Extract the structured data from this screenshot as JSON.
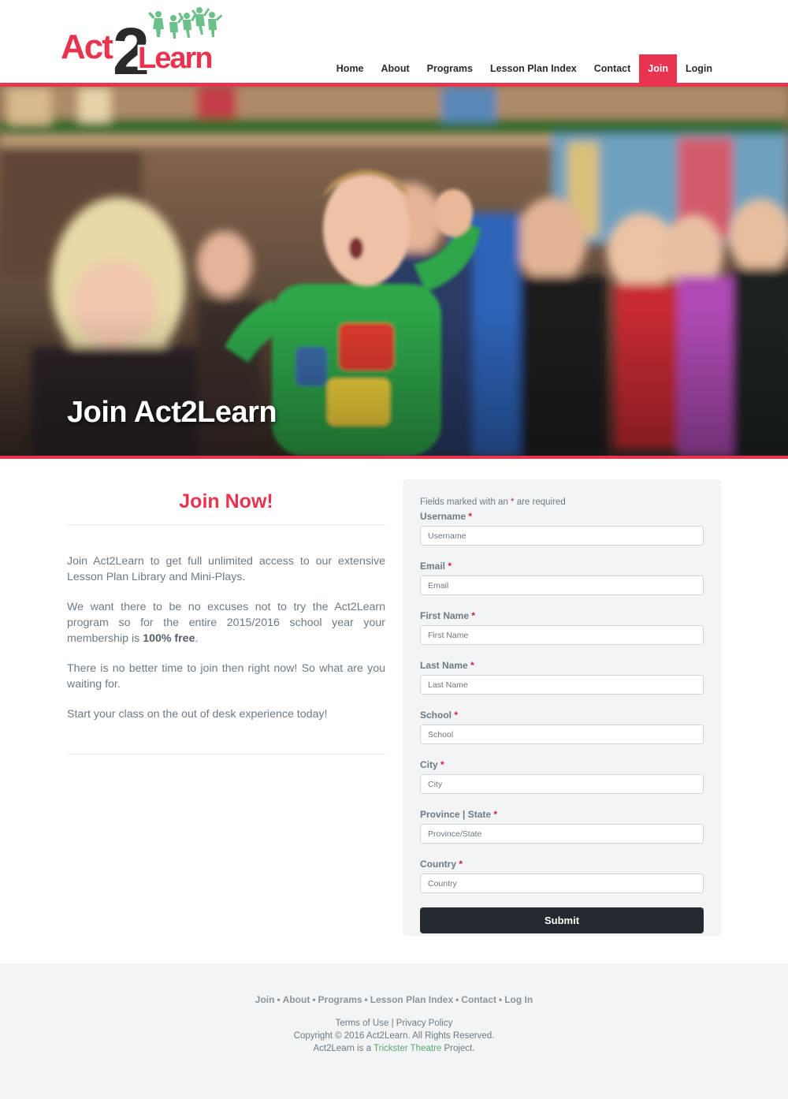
{
  "brand": {
    "logo_text_left": "Act",
    "logo_text_num": "2",
    "logo_text_right": "Learn"
  },
  "nav": {
    "items": [
      {
        "label": "Home"
      },
      {
        "label": "About"
      },
      {
        "label": "Programs"
      },
      {
        "label": "Lesson Plan Index"
      },
      {
        "label": "Contact"
      },
      {
        "label": "Join",
        "active": true
      },
      {
        "label": "Login"
      }
    ]
  },
  "hero": {
    "title": "Join Act2Learn"
  },
  "intro": {
    "heading": "Join Now!",
    "p1": "Join Act2Learn to get full unlimited access to our extensive Lesson Plan Library and Mini-Plays.",
    "p2_pre": "We want there to be no excuses not to try the Act2Learn program so for the entire 2015/2016 school year your membership is ",
    "p2_bold": "100% free",
    "p2_post": ".",
    "p3": "There is no better time to join then right now! So what are you waiting for.",
    "p4": "Start your class on the out of desk experience today!"
  },
  "form": {
    "required_note_pre": "Fields marked with an ",
    "required_star": "*",
    "required_note_post": " are required",
    "fields": [
      {
        "label": "Username",
        "placeholder": "Username"
      },
      {
        "label": "Email",
        "placeholder": "Email"
      },
      {
        "label": "First Name",
        "placeholder": "First Name"
      },
      {
        "label": "Last Name",
        "placeholder": "Last Name"
      },
      {
        "label": "School",
        "placeholder": "School"
      },
      {
        "label": "City",
        "placeholder": "City"
      },
      {
        "label": "Province | State",
        "placeholder": "Province/State"
      },
      {
        "label": "Country",
        "placeholder": "Country"
      }
    ],
    "submit_label": "Submit"
  },
  "footer": {
    "links": [
      "Join",
      "About",
      "Programs",
      "Lesson Plan Index",
      "Contact",
      "Log In"
    ],
    "separator": "•",
    "terms": "Terms of Use",
    "pipe": "|",
    "privacy": "Privacy Policy",
    "copyright": "Copyright © 2016 Act2Learn. All Rights Reserved.",
    "project_pre": "Act2Learn is a ",
    "project_link": "Trickster Theatre",
    "project_post": " Project."
  },
  "colors": {
    "accent": "#e8344e",
    "dark_button": "#24292f",
    "panel": "#f2f4f5",
    "link_green": "#5aa870"
  }
}
